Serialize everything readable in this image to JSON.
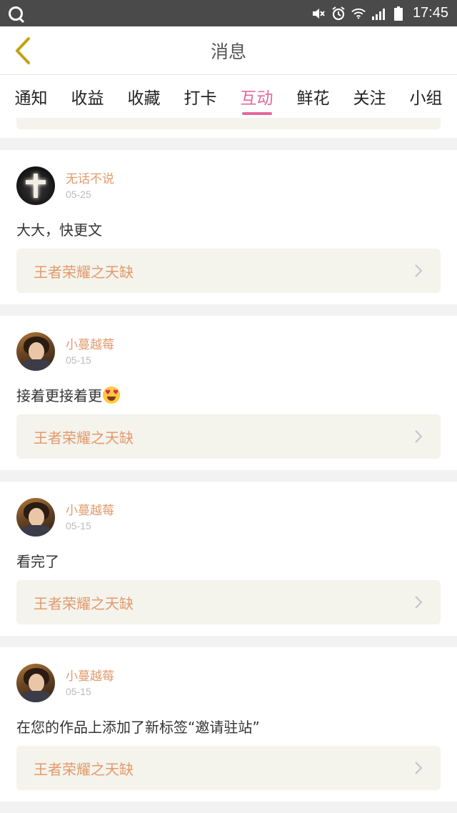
{
  "statusbar": {
    "time": "17:45"
  },
  "header": {
    "title": "消息"
  },
  "tabs": [
    {
      "label": "通知"
    },
    {
      "label": "收益"
    },
    {
      "label": "收藏"
    },
    {
      "label": "打卡"
    },
    {
      "label": "互动"
    },
    {
      "label": "鲜花"
    },
    {
      "label": "关注"
    },
    {
      "label": "小组"
    }
  ],
  "active_tab": "互动",
  "feed": [
    {
      "username": "无话不说",
      "date": "05-25",
      "message": "大大，快更文",
      "work_title": "王者荣耀之天缺"
    },
    {
      "username": "小蔓越莓",
      "date": "05-15",
      "message": "接着更接着更",
      "emoji": "smiling-face-with-heart-eyes",
      "work_title": "王者荣耀之天缺"
    },
    {
      "username": "小蔓越莓",
      "date": "05-15",
      "message": "看完了",
      "work_title": "王者荣耀之天缺"
    },
    {
      "username": "小蔓越莓",
      "date": "05-15",
      "message": "在您的作品上添加了新标签“邀请驻站”",
      "work_title": "王者荣耀之天缺"
    }
  ],
  "colors": {
    "accent": "#e5689a",
    "username": "#e29a6c",
    "link_bg": "#f4f3ec",
    "back_arrow": "#d8b62a"
  }
}
